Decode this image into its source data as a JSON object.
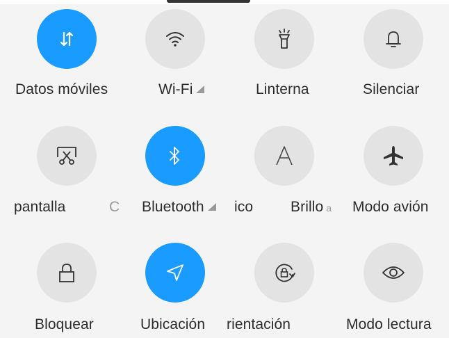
{
  "tiles": [
    {
      "label": "Datos móviles",
      "icon": "mobile-data-icon",
      "active": true
    },
    {
      "label": "Wi-Fi",
      "icon": "wifi-icon",
      "active": false
    },
    {
      "label": "Linterna",
      "icon": "flashlight-icon",
      "active": false
    },
    {
      "label": "Silenciar",
      "icon": "bell-icon",
      "active": false
    },
    {
      "label": "pantalla",
      "icon": "screenshot-scissors-icon",
      "active": false
    },
    {
      "label": "Bluetooth",
      "icon": "bluetooth-icon",
      "active": true
    },
    {
      "label": "Brillo",
      "icon": "auto-brightness-icon",
      "active": false
    },
    {
      "label": "Modo avión",
      "icon": "airplane-icon",
      "active": false
    },
    {
      "label": "Bloquear",
      "icon": "lock-icon",
      "active": false
    },
    {
      "label": "Ubicación",
      "icon": "location-icon",
      "active": true
    },
    {
      "label": "rientación",
      "icon": "rotation-lock-icon",
      "active": false
    },
    {
      "label": "Modo lectura",
      "icon": "eye-icon",
      "active": false
    }
  ],
  "partial_labels": {
    "left_of_bluetooth": "C",
    "left_of_brillo": "ico"
  },
  "colors": {
    "active": "#1a9bff",
    "inactive": "#e3e3e3",
    "background": "#f4f4f4"
  }
}
